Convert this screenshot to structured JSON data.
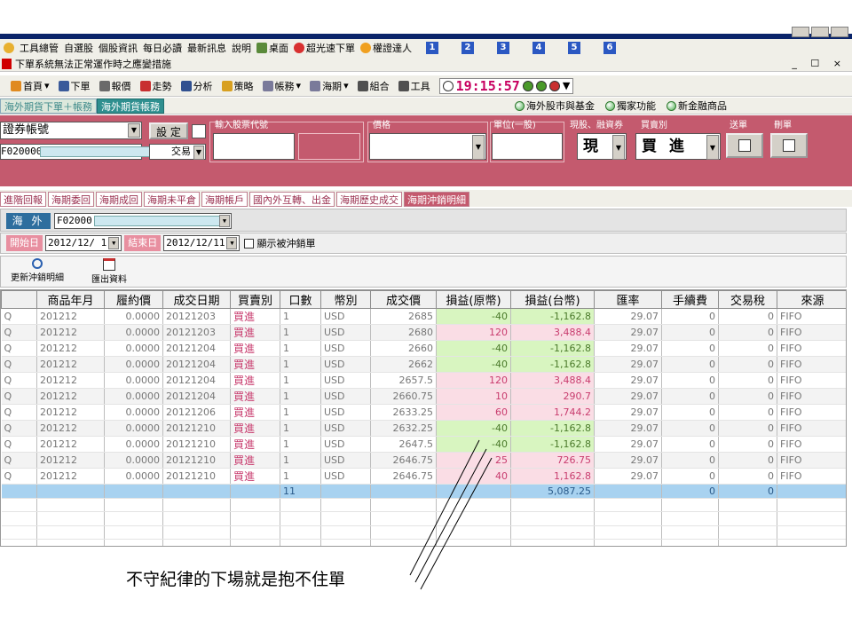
{
  "menu": {
    "items": [
      "工具總管",
      "自選股",
      "個股資訊",
      "每日必讀",
      "最新訊息",
      "說明",
      "桌面",
      "超光速下單",
      "權證達人"
    ],
    "numbers": [
      "1",
      "2",
      "3",
      "4",
      "5",
      "6"
    ]
  },
  "notice": {
    "text": "下單系統無法正常運作時之應變措施",
    "mdi": "_ ☐ ×"
  },
  "toolbar": {
    "items": [
      "首頁",
      "下單",
      "報價",
      "走勢",
      "分析",
      "策略",
      "帳務",
      "海期",
      "組合",
      "工具"
    ],
    "clock": "19:15:57"
  },
  "subtabs": {
    "items": [
      {
        "label": "海外期貨下單＋帳務",
        "active": false
      },
      {
        "label": "海外期貨帳務",
        "active": true
      }
    ],
    "links": [
      "海外股市與基金",
      "獨家功能",
      "新金融商品"
    ]
  },
  "order": {
    "account_label": "證券帳號",
    "set_button": "設 定",
    "account_prefix": "F020000",
    "trade_label": "交易",
    "stock_code_label": "輸入股票代號",
    "price_label": "價格",
    "unit_label": "單位(一股)",
    "cash_label": "現股、融資券",
    "cash_value": "現",
    "side_label": "買賣別",
    "side_value": "買 進",
    "send_label": "送單",
    "delete_label": "刪單"
  },
  "report_tabs": [
    {
      "label": "進階回報",
      "active": false
    },
    {
      "label": "海期委回",
      "active": false
    },
    {
      "label": "海期成回",
      "active": false
    },
    {
      "label": "海期未平倉",
      "active": false
    },
    {
      "label": "海期帳戶",
      "active": false
    },
    {
      "label": "國內外互轉、出金",
      "active": false
    },
    {
      "label": "海期歷史成交",
      "active": false
    },
    {
      "label": "海期沖銷明細",
      "active": true
    }
  ],
  "market": {
    "badge": "海 外",
    "account": "F02000"
  },
  "dates": {
    "start_label": "開始日",
    "start_value": "2012/12/ 1",
    "end_label": "結束日",
    "end_value": "2012/12/11",
    "show_label": "顯示被沖銷單"
  },
  "actions": {
    "refresh": "更新沖銷明細",
    "export": "匯出資料"
  },
  "table": {
    "columns": [
      "",
      "商品年月",
      "履約價",
      "成交日期",
      "買賣別",
      "口數",
      "幣別",
      "成交價",
      "損益(原幣)",
      "損益(台幣)",
      "匯率",
      "手續費",
      "交易稅",
      "來源"
    ],
    "rows": [
      [
        "Q",
        "201212",
        "0.0000",
        "20121203",
        "買進",
        "1",
        "USD",
        "2685",
        "-40",
        "-1,162.8",
        "29.07",
        "0",
        "0",
        "FIFO"
      ],
      [
        "Q",
        "201212",
        "0.0000",
        "20121203",
        "買進",
        "1",
        "USD",
        "2680",
        "120",
        "3,488.4",
        "29.07",
        "0",
        "0",
        "FIFO"
      ],
      [
        "Q",
        "201212",
        "0.0000",
        "20121204",
        "買進",
        "1",
        "USD",
        "2660",
        "-40",
        "-1,162.8",
        "29.07",
        "0",
        "0",
        "FIFO"
      ],
      [
        "Q",
        "201212",
        "0.0000",
        "20121204",
        "買進",
        "1",
        "USD",
        "2662",
        "-40",
        "-1,162.8",
        "29.07",
        "0",
        "0",
        "FIFO"
      ],
      [
        "Q",
        "201212",
        "0.0000",
        "20121204",
        "買進",
        "1",
        "USD",
        "2657.5",
        "120",
        "3,488.4",
        "29.07",
        "0",
        "0",
        "FIFO"
      ],
      [
        "Q",
        "201212",
        "0.0000",
        "20121204",
        "買進",
        "1",
        "USD",
        "2660.75",
        "10",
        "290.7",
        "29.07",
        "0",
        "0",
        "FIFO"
      ],
      [
        "Q",
        "201212",
        "0.0000",
        "20121206",
        "買進",
        "1",
        "USD",
        "2633.25",
        "60",
        "1,744.2",
        "29.07",
        "0",
        "0",
        "FIFO"
      ],
      [
        "Q",
        "201212",
        "0.0000",
        "20121210",
        "買進",
        "1",
        "USD",
        "2632.25",
        "-40",
        "-1,162.8",
        "29.07",
        "0",
        "0",
        "FIFO"
      ],
      [
        "Q",
        "201212",
        "0.0000",
        "20121210",
        "買進",
        "1",
        "USD",
        "2647.5",
        "-40",
        "-1,162.8",
        "29.07",
        "0",
        "0",
        "FIFO"
      ],
      [
        "Q",
        "201212",
        "0.0000",
        "20121210",
        "買進",
        "1",
        "USD",
        "2646.75",
        "25",
        "726.75",
        "29.07",
        "0",
        "0",
        "FIFO"
      ],
      [
        "Q",
        "201212",
        "0.0000",
        "20121210",
        "買進",
        "1",
        "USD",
        "2646.75",
        "40",
        "1,162.8",
        "29.07",
        "0",
        "0",
        "FIFO"
      ]
    ],
    "total": [
      "",
      "",
      "",
      "",
      "",
      "11",
      "",
      "",
      "",
      "5,087.25",
      "",
      "0",
      "0",
      ""
    ]
  },
  "caption": "不守紀律的下場就是抱不住單",
  "colors": {
    "order_panel": "#c45a6e",
    "profit_bg": "#fadde5",
    "loss_bg": "#d8f5c0",
    "total_bg": "#a8d2f0",
    "clock": "#c80060"
  }
}
